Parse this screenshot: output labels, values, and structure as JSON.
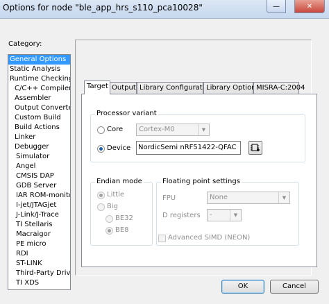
{
  "window": {
    "title": "Options for node \"ble_app_hrs_s110_pca10028\""
  },
  "category": {
    "label": "Category:",
    "items": [
      {
        "label": "General Options",
        "selected": true,
        "level": 1
      },
      {
        "label": "Static Analysis",
        "level": 1
      },
      {
        "label": "Runtime Checking",
        "level": 1
      },
      {
        "label": "C/C++ Compiler",
        "level": 2
      },
      {
        "label": "Assembler",
        "level": 2
      },
      {
        "label": "Output Converter",
        "level": 2
      },
      {
        "label": "Custom Build",
        "level": 2
      },
      {
        "label": "Build Actions",
        "level": 2
      },
      {
        "label": "Linker",
        "level": 2
      },
      {
        "label": "Debugger",
        "level": 2
      },
      {
        "label": "Simulator",
        "level": 3
      },
      {
        "label": "Angel",
        "level": 3
      },
      {
        "label": "CMSIS DAP",
        "level": 3
      },
      {
        "label": "GDB Server",
        "level": 3
      },
      {
        "label": "IAR ROM-monitor",
        "level": 3
      },
      {
        "label": "I-jet/JTAGjet",
        "level": 3
      },
      {
        "label": "J-Link/J-Trace",
        "level": 3
      },
      {
        "label": "TI Stellaris",
        "level": 3
      },
      {
        "label": "Macraigor",
        "level": 3
      },
      {
        "label": "PE micro",
        "level": 3
      },
      {
        "label": "RDI",
        "level": 3
      },
      {
        "label": "ST-LINK",
        "level": 3
      },
      {
        "label": "Third-Party Driver",
        "level": 3
      },
      {
        "label": "TI XDS",
        "level": 3
      }
    ]
  },
  "tabs": [
    {
      "label": "Target",
      "active": true
    },
    {
      "label": "Output"
    },
    {
      "label": "Library Configuration"
    },
    {
      "label": "Library Options"
    },
    {
      "label": "MISRA-C:2004"
    }
  ],
  "processor": {
    "group_title": "Processor variant",
    "core_label": "Core",
    "core_value": "Cortex-M0",
    "device_label": "Device",
    "device_value": "NordicSemi nRF51422-QFAC",
    "selected": "device"
  },
  "endian": {
    "group_title": "Endian mode",
    "little": "Little",
    "big": "Big",
    "be32": "BE32",
    "be8": "BE8"
  },
  "fpu": {
    "group_title": "Floating point settings",
    "fpu_label": "FPU",
    "fpu_value": "None",
    "dreg_label": "D registers",
    "dreg_value": "-",
    "simd_label": "Advanced SIMD (NEON)"
  },
  "buttons": {
    "ok": "OK",
    "cancel": "Cancel"
  }
}
